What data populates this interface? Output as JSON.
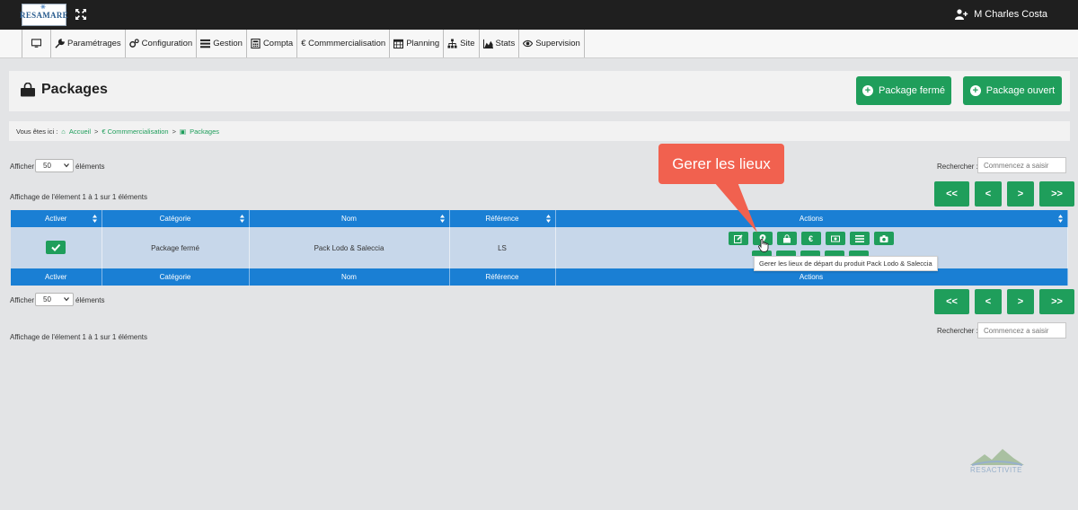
{
  "brand": {
    "logo_text": "RESAMARE"
  },
  "user": {
    "name": "M Charles Costa"
  },
  "menu": [
    {
      "label": "Paramétrages"
    },
    {
      "label": "Configuration"
    },
    {
      "label": "Gestion"
    },
    {
      "label": "Compta"
    },
    {
      "label": "€ Commmercialisation"
    },
    {
      "label": "Planning"
    },
    {
      "label": "Site"
    },
    {
      "label": "Stats"
    },
    {
      "label": "Supervision"
    }
  ],
  "page": {
    "title": "Packages",
    "btn_closed": "Package fermé",
    "btn_open": "Package ouvert"
  },
  "breadcrumb": {
    "prefix": "Vous êtes ici :",
    "home": "Accueil",
    "section": "€ Commmercialisation",
    "current": "Packages",
    "sep": ">"
  },
  "listing": {
    "show_label": "Afficher",
    "page_size": "50",
    "elements_label": "éléments",
    "search_label": "Rechercher :",
    "search_placeholder": "Commencez a saisir",
    "info": "Affichage de l'élement 1 à 1 sur 1 éléments"
  },
  "pager": {
    "first": "<<",
    "prev": "<",
    "next": ">",
    "last": ">>"
  },
  "table": {
    "columns": [
      "Activer",
      "Catégorie",
      "Nom",
      "Référence",
      "Actions"
    ],
    "rows": [
      {
        "category": "Package fermé",
        "name": "Pack Lodo & Saleccia",
        "reference": "LS"
      }
    ]
  },
  "actions_icons": [
    "edit-icon",
    "map-marker-icon",
    "shopping-bag-icon",
    "euro-icon",
    "money-icon",
    "list-icon",
    "camera-icon"
  ],
  "tooltip": "Gerer les lieux de départ du produit Pack Lodo & Saleccia",
  "callout": "Gerer les lieux",
  "watermark": {
    "text": "RESACTIVITE"
  },
  "colors": {
    "green": "#1f9e5b",
    "blue_header": "#1a7fd4",
    "row_bg": "#c7d7ea",
    "callout": "#f1614f",
    "topbar": "#1f1f1f"
  }
}
